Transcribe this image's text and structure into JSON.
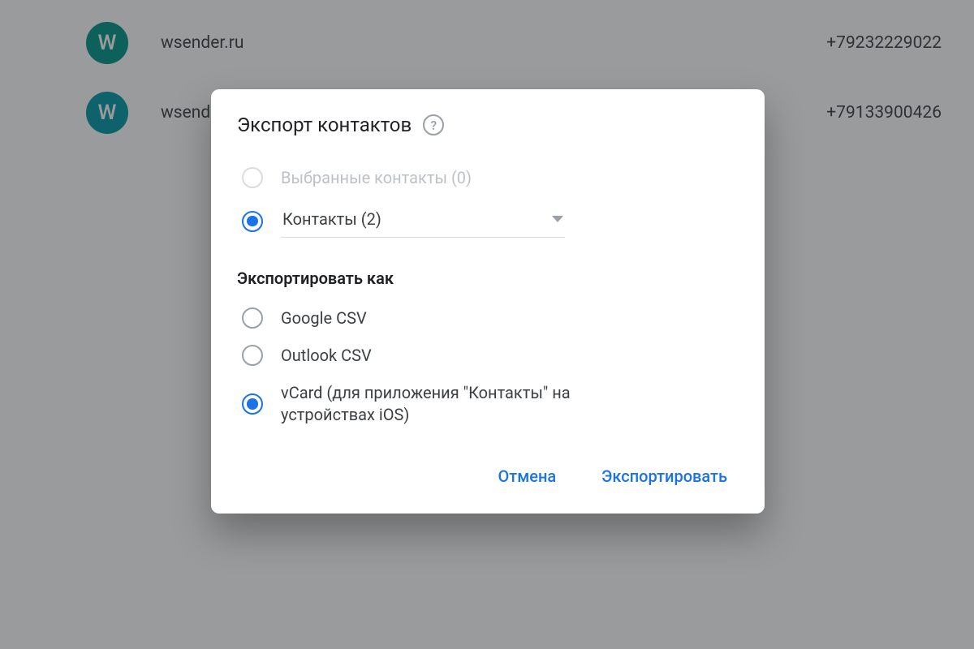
{
  "contacts": [
    {
      "initial": "W",
      "name": "wsender.ru",
      "phone": "+79232229022",
      "avatarClass": "teal"
    },
    {
      "initial": "W",
      "name": "wsender.ru",
      "phone": "+79133900426",
      "avatarClass": "blue"
    }
  ],
  "dialog": {
    "title": "Экспорт контактов",
    "source": {
      "selectedLabel": "Выбранные контакты (0)",
      "contactsLabel": "Контакты (2)"
    },
    "exportAsLabel": "Экспортировать как",
    "formats": {
      "googleCsv": "Google CSV",
      "outlookCsv": "Outlook CSV",
      "vcard": "vCard (для приложения \"Контакты\" на устройствах iOS)"
    },
    "actions": {
      "cancel": "Отмена",
      "export": "Экспортировать"
    }
  }
}
